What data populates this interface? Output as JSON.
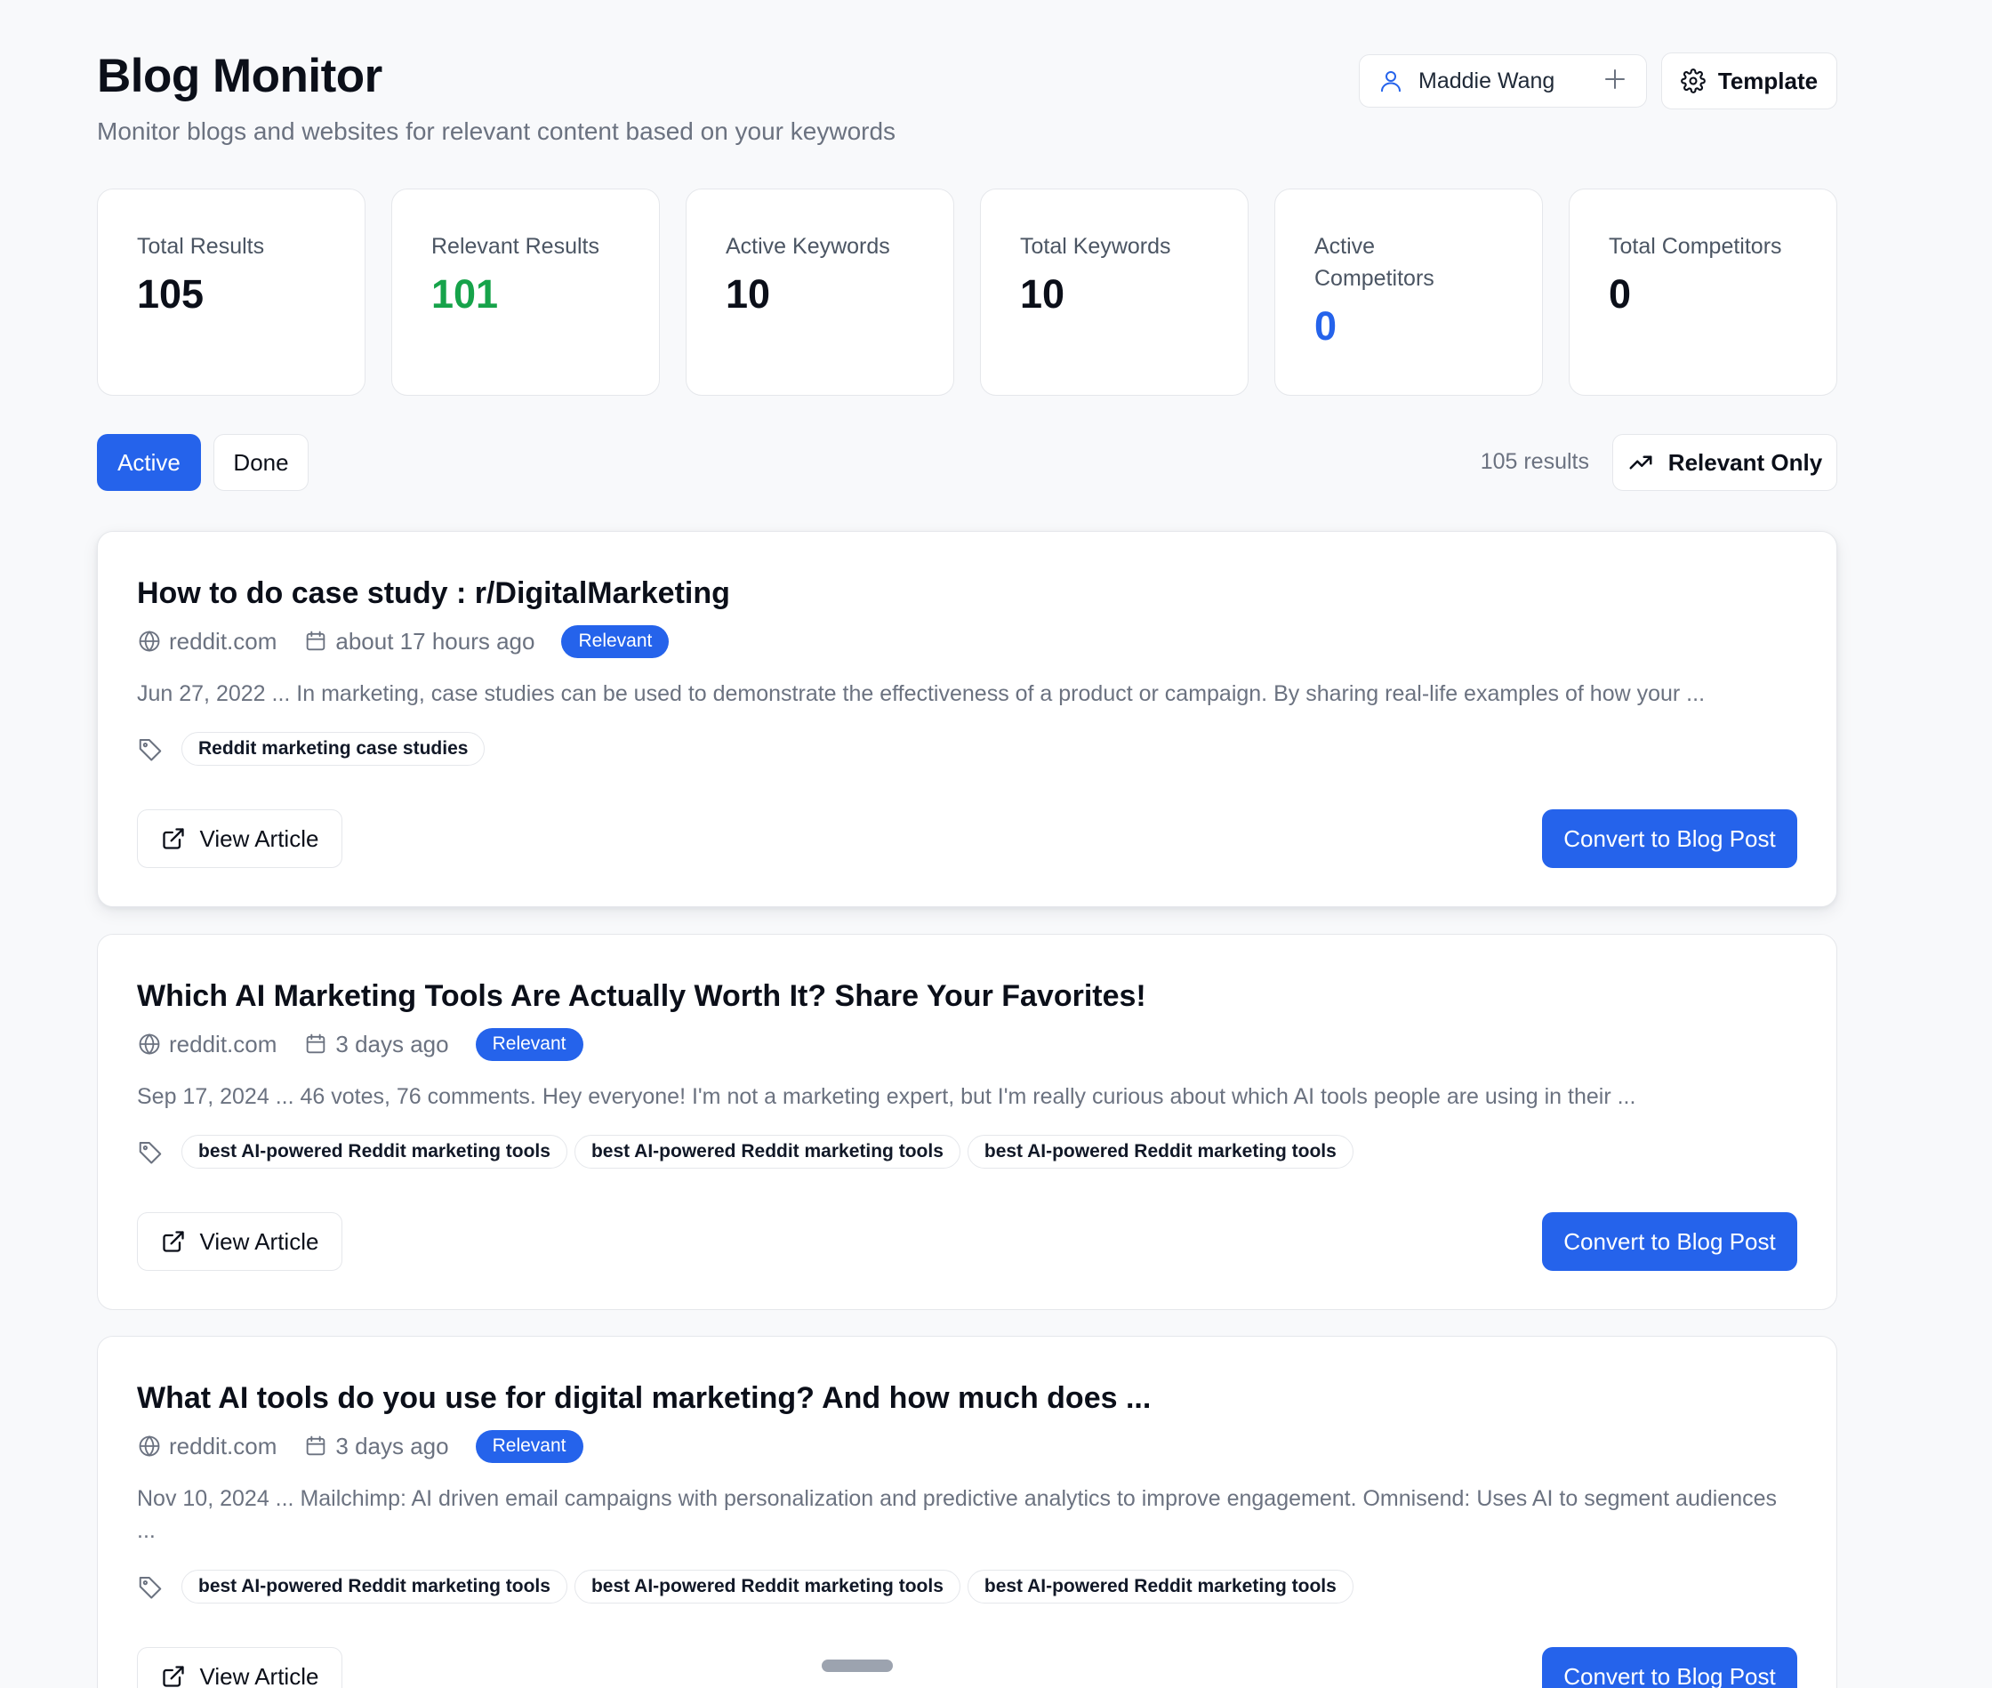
{
  "header": {
    "title": "Blog Monitor",
    "subtitle": "Monitor blogs and websites for relevant content based on your keywords",
    "user_name": "Maddie Wang",
    "template_label": "Template"
  },
  "stats": [
    {
      "label": "Total Results",
      "value": "105",
      "color": "#0b0f19"
    },
    {
      "label": "Relevant Results",
      "value": "101",
      "color": "#16a34a"
    },
    {
      "label": "Active Keywords",
      "value": "10",
      "color": "#0b0f19"
    },
    {
      "label": "Total Keywords",
      "value": "10",
      "color": "#0b0f19"
    },
    {
      "label": "Active Competitors",
      "value": "0",
      "color": "#2563eb"
    },
    {
      "label": "Total Competitors",
      "value": "0",
      "color": "#0b0f19"
    }
  ],
  "toolbar": {
    "tab_active": "Active",
    "tab_done": "Done",
    "results_count": "105 results",
    "relevant_only_label": "Relevant Only"
  },
  "articles": [
    {
      "title": "How to do case study : r/DigitalMarketing",
      "source": "reddit.com",
      "time": "about 17 hours ago",
      "badge": "Relevant",
      "excerpt": "Jun 27, 2022 ... In marketing, case studies can be used to demonstrate the effectiveness of a product or campaign. By sharing real-life examples of how your ...",
      "tags": [
        "Reddit marketing case studies"
      ],
      "view_label": "View Article",
      "convert_label": "Convert to Blog Post"
    },
    {
      "title": "Which AI Marketing Tools Are Actually Worth It? Share Your Favorites!",
      "source": "reddit.com",
      "time": "3 days ago",
      "badge": "Relevant",
      "excerpt": "Sep 17, 2024 ... 46 votes, 76 comments. Hey everyone! I'm not a marketing expert, but I'm really curious about which AI tools people are using in their ...",
      "tags": [
        "best AI-powered Reddit marketing tools",
        "best AI-powered Reddit marketing tools",
        "best AI-powered Reddit marketing tools"
      ],
      "view_label": "View Article",
      "convert_label": "Convert to Blog Post"
    },
    {
      "title": "What AI tools do you use for digital marketing? And how much does ...",
      "source": "reddit.com",
      "time": "3 days ago",
      "badge": "Relevant",
      "excerpt": "Nov 10, 2024 ... Mailchimp: AI driven email campaigns with personalization and predictive analytics to improve engagement. Omnisend: Uses AI to segment audiences ...",
      "tags": [
        "best AI-powered Reddit marketing tools",
        "best AI-powered Reddit marketing tools",
        "best AI-powered Reddit marketing tools"
      ],
      "view_label": "View Article",
      "convert_label": "Convert to Blog Post"
    }
  ]
}
